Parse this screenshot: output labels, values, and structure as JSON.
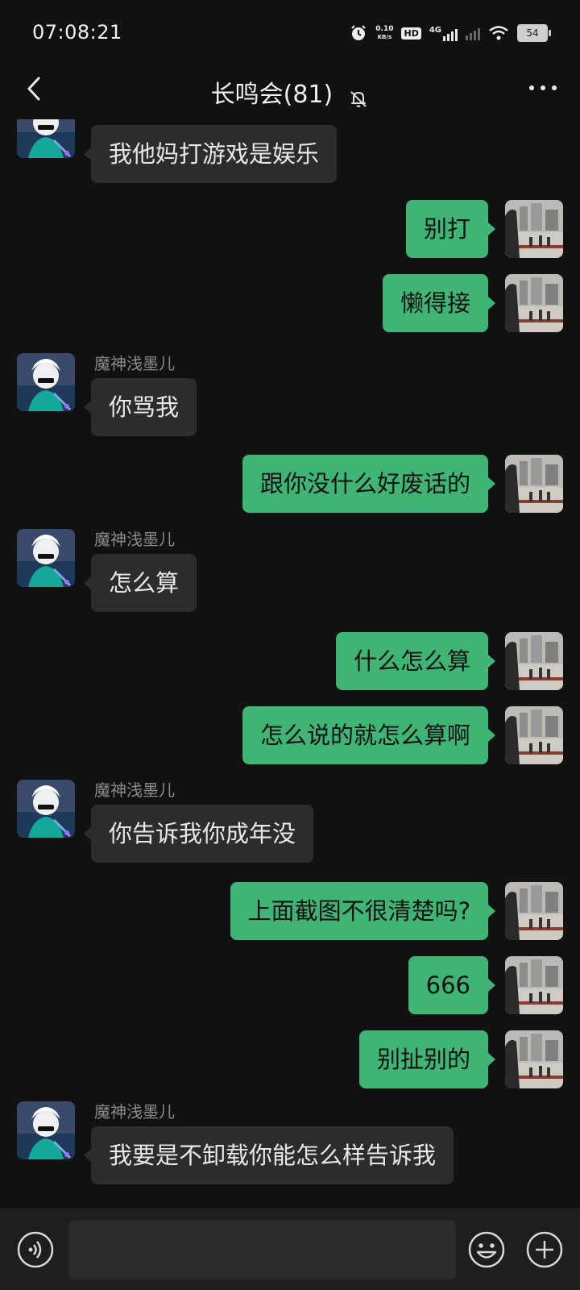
{
  "status": {
    "time": "07:08:21",
    "net_speed_value": "0.10",
    "net_speed_unit": "KB/s",
    "hd_label": "HD",
    "network_label": "4G",
    "battery": "54",
    "icons": [
      "alarm-icon",
      "hd-icon",
      "signal-icon",
      "wifi-icon",
      "battery-icon"
    ]
  },
  "nav": {
    "title": "长鸣会(81)",
    "icons": [
      "back-chevron-icon",
      "mute-bell-icon",
      "more-dots-icon"
    ]
  },
  "colors": {
    "background": "#111111",
    "incoming_bubble": "#2c2c2c",
    "outgoing_bubble": "#3eb575",
    "sender_name": "#8b8b8b"
  },
  "messages": [
    {
      "dir": "in",
      "sender": "魔神浅墨儿",
      "text": "我他妈打游戏是娱乐"
    },
    {
      "dir": "out",
      "text": "别打"
    },
    {
      "dir": "out",
      "text": "懒得接"
    },
    {
      "dir": "in",
      "sender": "魔神浅墨儿",
      "text": "你骂我"
    },
    {
      "dir": "out",
      "text": "跟你没什么好废话的"
    },
    {
      "dir": "in",
      "sender": "魔神浅墨儿",
      "text": "怎么算"
    },
    {
      "dir": "out",
      "text": "什么怎么算"
    },
    {
      "dir": "out",
      "text": "怎么说的就怎么算啊"
    },
    {
      "dir": "in",
      "sender": "魔神浅墨儿",
      "text": "你告诉我你成年没"
    },
    {
      "dir": "out",
      "text": "上面截图不很清楚吗?"
    },
    {
      "dir": "out",
      "text": "666"
    },
    {
      "dir": "out",
      "text": "别扯别的"
    },
    {
      "dir": "in",
      "sender": "魔神浅墨儿",
      "text": "我要是不卸载你能怎么样告诉我"
    }
  ],
  "input": {
    "value": "",
    "icons": [
      "voice-icon",
      "emoji-icon",
      "plus-icon"
    ]
  }
}
